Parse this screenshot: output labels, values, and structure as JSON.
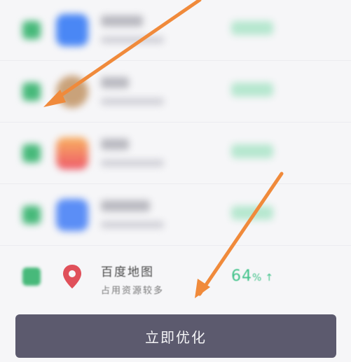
{
  "apps": [
    {
      "icon": "phone-manager-icon",
      "icon_color": "#4a87f5",
      "blurred": true
    },
    {
      "icon": "avatar-icon",
      "icon_color": "#c9a27a",
      "blurred": true
    },
    {
      "icon": "gallery-icon",
      "icon_color": "#f07b5a",
      "blurred": true
    },
    {
      "icon": "settings-app-icon",
      "icon_color": "#5b8ef6",
      "blurred": true
    },
    {
      "icon": "map-pin-icon",
      "icon_color": "#e0505a",
      "blurred": false,
      "name": "百度地图",
      "subtitle": "占用资源较多",
      "percent": "64",
      "percent_unit": "%",
      "trend": "↑"
    }
  ],
  "cta": {
    "label": "立即优化"
  },
  "colors": {
    "accent_green": "#43c38b",
    "cta_bg": "#5c5a6e",
    "arrow": "#f08a3b"
  }
}
